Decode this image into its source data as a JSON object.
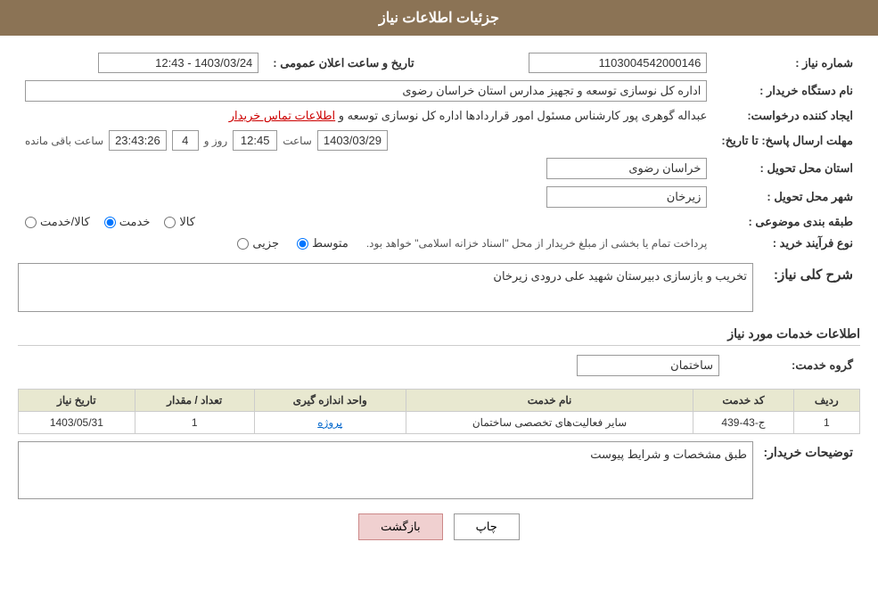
{
  "header": {
    "title": "جزئیات اطلاعات نیاز"
  },
  "fields": {
    "need_number_label": "شماره نیاز :",
    "need_number_value": "1103004542000146",
    "buyer_org_label": "نام دستگاه خریدار :",
    "buyer_org_value": "اداره کل نوسازی  توسعه و تجهیز مدارس استان خراسان رضوی",
    "creator_label": "ایجاد کننده درخواست:",
    "creator_value": "عبداله گوهری پور کارشناس مسئول امور قراردادها  اداره کل نوسازی  توسعه و ",
    "creator_link": "اطلاعات تماس خریدار",
    "announce_date_label": "تاریخ و ساعت اعلان عمومی :",
    "announce_date_value": "1403/03/24 - 12:43",
    "deadline_label": "مهلت ارسال پاسخ: تا تاریخ:",
    "deadline_date": "1403/03/29",
    "deadline_time": "12:45",
    "deadline_days": "4",
    "deadline_remaining": "23:43:26",
    "deadline_remaining_label": "ساعت باقی مانده",
    "deadline_days_label": "روز و",
    "province_label": "استان محل تحویل :",
    "province_value": "خراسان رضوی",
    "city_label": "شهر محل تحویل :",
    "city_value": "زیرخان",
    "category_label": "طبقه بندی موضوعی :",
    "category_options": [
      "کالا",
      "خدمت",
      "کالا/خدمت"
    ],
    "category_selected": "خدمت",
    "purchase_type_label": "نوع فرآیند خرید :",
    "purchase_type_options": [
      "جزیی",
      "متوسط"
    ],
    "purchase_type_note": "پرداخت تمام یا بخشی از مبلغ خریدار از محل \"اسناد خزانه اسلامی\" خواهد بود.",
    "need_desc_label": "شرح کلی نیاز:",
    "need_desc_value": "تخریب و بازسازی دبیرستان شهید علی درودی زیرخان",
    "services_label": "اطلاعات خدمات مورد نیاز",
    "service_group_label": "گروه خدمت:",
    "service_group_value": "ساختمان",
    "table": {
      "columns": [
        "ردیف",
        "کد خدمت",
        "نام خدمت",
        "واحد اندازه گیری",
        "تعداد / مقدار",
        "تاریخ نیاز"
      ],
      "rows": [
        {
          "row": "1",
          "code": "ج-43-439",
          "name": "سایر فعالیت‌های تخصصی ساختمان",
          "unit": "پروژه",
          "qty": "1",
          "date": "1403/05/31"
        }
      ]
    },
    "buyer_desc_label": "توضیحات خریدار:",
    "buyer_desc_value": "طبق مشخصات و شرایط پیوست"
  },
  "buttons": {
    "print": "چاپ",
    "back": "بازگشت"
  }
}
